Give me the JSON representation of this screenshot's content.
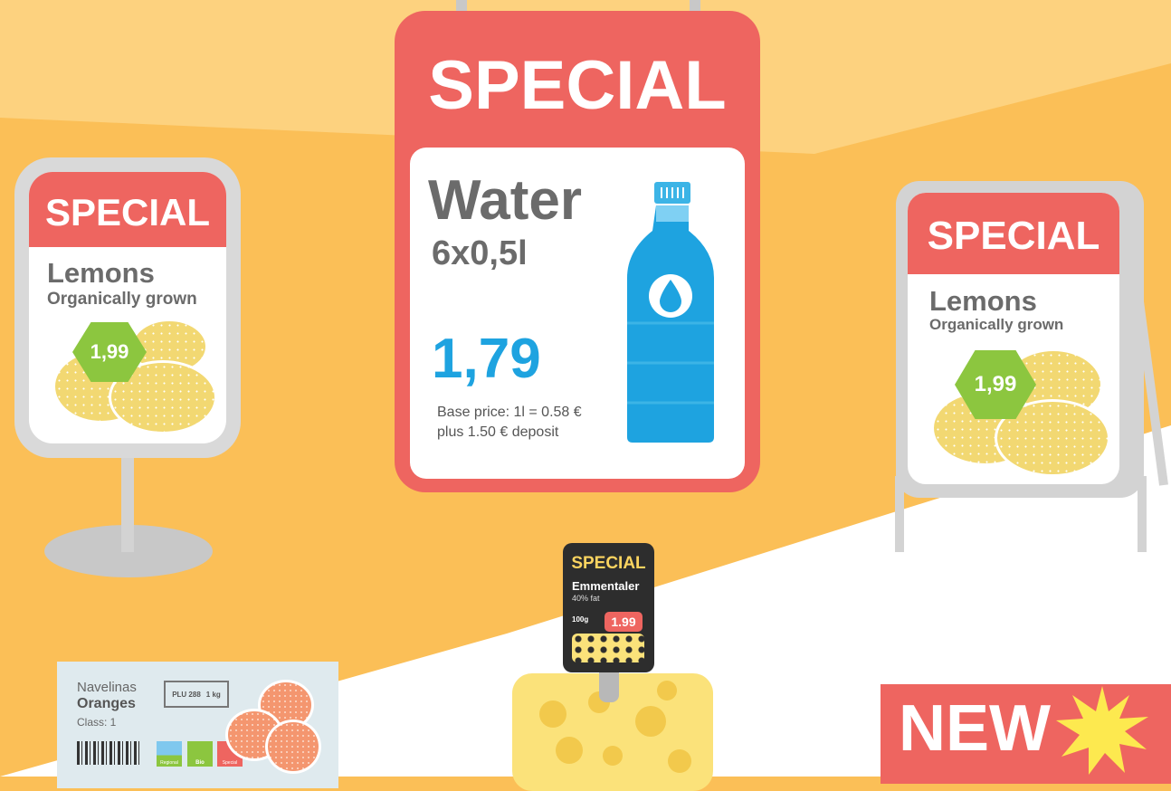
{
  "colors": {
    "background_light": "#fdd27f",
    "background_mid": "#fbbf57",
    "floor": "#ffffff",
    "special_red": "#ee6560",
    "price_blue": "#1ea3e0",
    "hex_green": "#8cc63f",
    "lemon": "#f2d872",
    "cheese": "#fbe27a"
  },
  "left_sign": {
    "banner": "SPECIAL",
    "title": "Lemons",
    "subtitle": "Organically grown",
    "price": "1,99"
  },
  "water_sign": {
    "banner": "SPECIAL",
    "title": "Water",
    "size": "6x0,5l",
    "price": "1,79",
    "base_price": "Base price: 1l = 0.58 €",
    "deposit": "plus 1.50 € deposit"
  },
  "right_sign": {
    "banner": "SPECIAL",
    "title": "Lemons",
    "subtitle": "Organically grown",
    "price": "1,99"
  },
  "cheese_tag": {
    "banner": "SPECIAL",
    "title": "Emmentaler",
    "fat": "40% fat",
    "weight": "100g",
    "price": "1.99"
  },
  "orange_label": {
    "variety": "Navelinas",
    "title": "Oranges",
    "class": "Class: 1",
    "plu": "PLU 288",
    "unit": "1 kg",
    "badges": [
      "Regional",
      "Bio",
      "Special"
    ]
  },
  "new_banner": {
    "text": "NEW"
  },
  "icons": [
    "water-bottle-icon",
    "water-drop-icon",
    "barcode-icon",
    "regional-badge-icon",
    "bio-leaf-icon",
    "special-badge-icon",
    "starburst-icon"
  ]
}
